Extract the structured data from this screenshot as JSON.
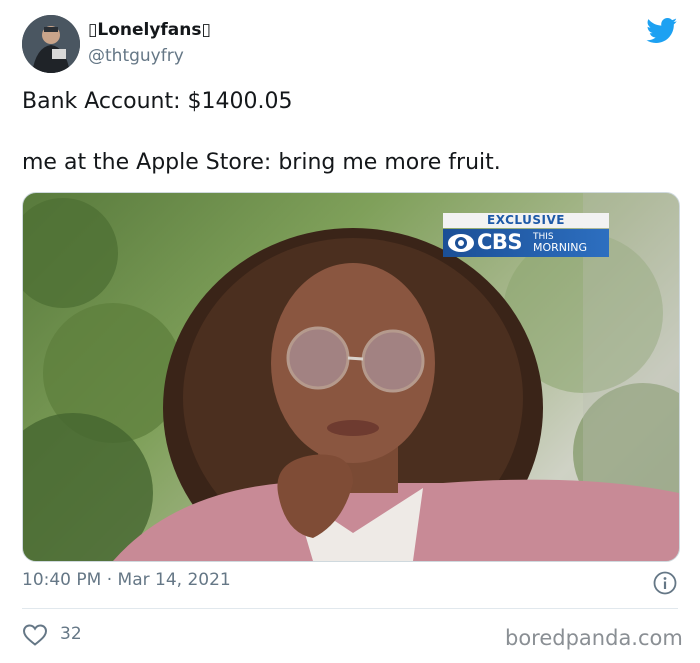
{
  "author": {
    "display_name": "▯Lonelyfans▯",
    "handle": "@thtguyfry",
    "avatar_icon": "profile-photo"
  },
  "brand_icon": "twitter-bird-icon",
  "brand_color": "#1da1f2",
  "tweet": {
    "line1": "Bank Account: $1400.05",
    "line2": "me at the Apple Store: bring me more fruit."
  },
  "media": {
    "overlay": {
      "top_label": "EXCLUSIVE",
      "network": "CBS",
      "show_line1": "THIS",
      "show_line2": "MORNING"
    }
  },
  "meta": {
    "time": "10:40 PM",
    "separator": "·",
    "date": "Mar 14, 2021"
  },
  "stats": {
    "likes": "32"
  },
  "watermark": "boredpanda.com"
}
